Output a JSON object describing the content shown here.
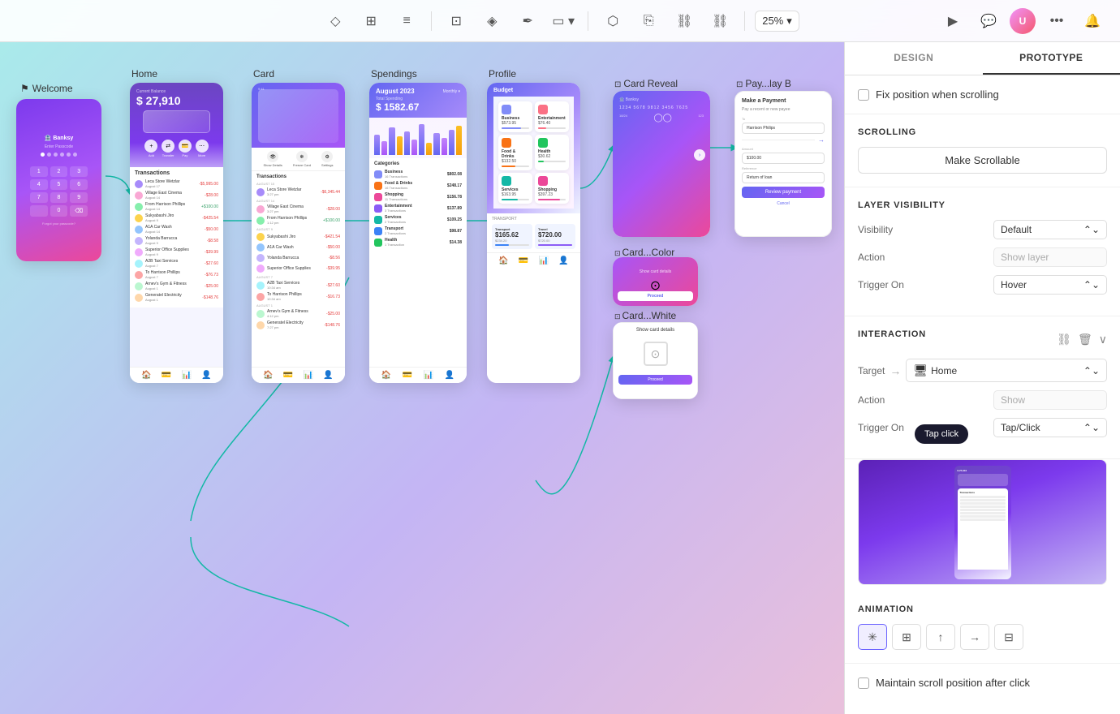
{
  "toolbar": {
    "zoom_label": "25%",
    "tools": [
      "diamond",
      "layout",
      "filter",
      "frame",
      "component",
      "pen",
      "rect-multi",
      "boolean",
      "copy",
      "link",
      "link2"
    ],
    "play_label": "▶",
    "more_label": "•••",
    "notification_label": "🔔"
  },
  "panel": {
    "design_tab": "DESIGN",
    "prototype_tab": "PROTOTYPE",
    "fix_position_label": "Fix position when scrolling",
    "scrolling_title": "SCROLLING",
    "make_scrollable_label": "Make Scrollable",
    "layer_visibility_title": "LAYER VISIBILITY",
    "visibility_label": "Visibility",
    "visibility_value": "Default",
    "action_label": "Action",
    "action_placeholder": "Show layer",
    "trigger_on_label": "Trigger On",
    "trigger_on_value": "Hover",
    "interaction_title": "INTERACTION",
    "target_label": "Target",
    "target_value": "Home",
    "interaction_action_label": "Action",
    "interaction_action_placeholder": "Show",
    "interaction_trigger_label": "Trigger On",
    "interaction_trigger_value": "Tap/Click",
    "animation_title": "Animation",
    "maintain_scroll_label": "Maintain scroll position after click"
  },
  "frames": {
    "welcome_label": "Welcome",
    "home_label": "Home",
    "card_label": "Card",
    "spendings_label": "Spendings",
    "profile_label": "Profile",
    "card_reveal_label": "Card Reveal",
    "pay_label": "Pay...lay B",
    "card_color_label": "Card...Color",
    "card_white_label": "Card...White"
  },
  "home_data": {
    "balance_label": "Current Balance",
    "amount": "$ 27,910",
    "transactions_title": "Transactions",
    "items": [
      {
        "name": "Leca Store Wetzlar",
        "date": "August 17",
        "amount": "-$5,995.00"
      },
      {
        "name": "Village East Cinema",
        "date": "August 14",
        "amount": "-$28.00"
      },
      {
        "name": "From Harrison Phillips",
        "date": "August 14",
        "amount": "+$100.00"
      },
      {
        "name": "Sukyabashi Jiro",
        "date": "August 9",
        "amount": "-$425.54"
      },
      {
        "name": "A1A Car Wash",
        "date": "August 14",
        "amount": "-$50.00"
      },
      {
        "name": "Yolanda Barrucca",
        "date": "August 9",
        "amount": "-$8.58"
      },
      {
        "name": "Superior Office Supplies",
        "date": "August 9",
        "amount": "-$39.99"
      },
      {
        "name": "A2B Taxi Services",
        "date": "August 7",
        "amount": "-$27.60"
      },
      {
        "name": "To Harrison Phillips",
        "date": "August 7",
        "amount": "-$76.73"
      },
      {
        "name": "Arnev's Gym & Fitness",
        "date": "August 1",
        "amount": "-$25.00"
      },
      {
        "name": "Generatel Electricity",
        "date": "August 1",
        "amount": "-$148.76"
      }
    ]
  },
  "card_reveal_data": {
    "number": "1234  5678  9812  3456  7625",
    "amount_label": "Amount",
    "amount_value": "$100.00",
    "reference_label": "Reference",
    "reference_value": "Return of loan",
    "review_btn": "Review payment",
    "cancel_btn": "Cancel"
  },
  "spendings_data": {
    "month": "August 2023",
    "total_spending": "Total Spending",
    "amount": "$ 1582.67",
    "categories": [
      {
        "name": "Business",
        "count": "16 Transactions",
        "amount": "$802.08"
      },
      {
        "name": "Food & Drinks",
        "count": "16 Transactions",
        "amount": "$248.17"
      },
      {
        "name": "Shopping",
        "count": "11 Transactions",
        "amount": "$156.78"
      },
      {
        "name": "Entertainment",
        "count": "3 Transactions",
        "amount": "$137.89"
      },
      {
        "name": "Services",
        "count": "2 Transactions",
        "amount": "$109.25"
      },
      {
        "name": "Transport",
        "count": "2 Transactions",
        "amount": "$98.87"
      },
      {
        "name": "Health",
        "count": "1 Transaction",
        "amount": "$14.38"
      }
    ]
  },
  "tap_click_label": "Tap click",
  "colors": {
    "purple": "#6366f1",
    "teal": "#14b8a6",
    "accent": "#a855f7",
    "pink": "#ec4899"
  }
}
